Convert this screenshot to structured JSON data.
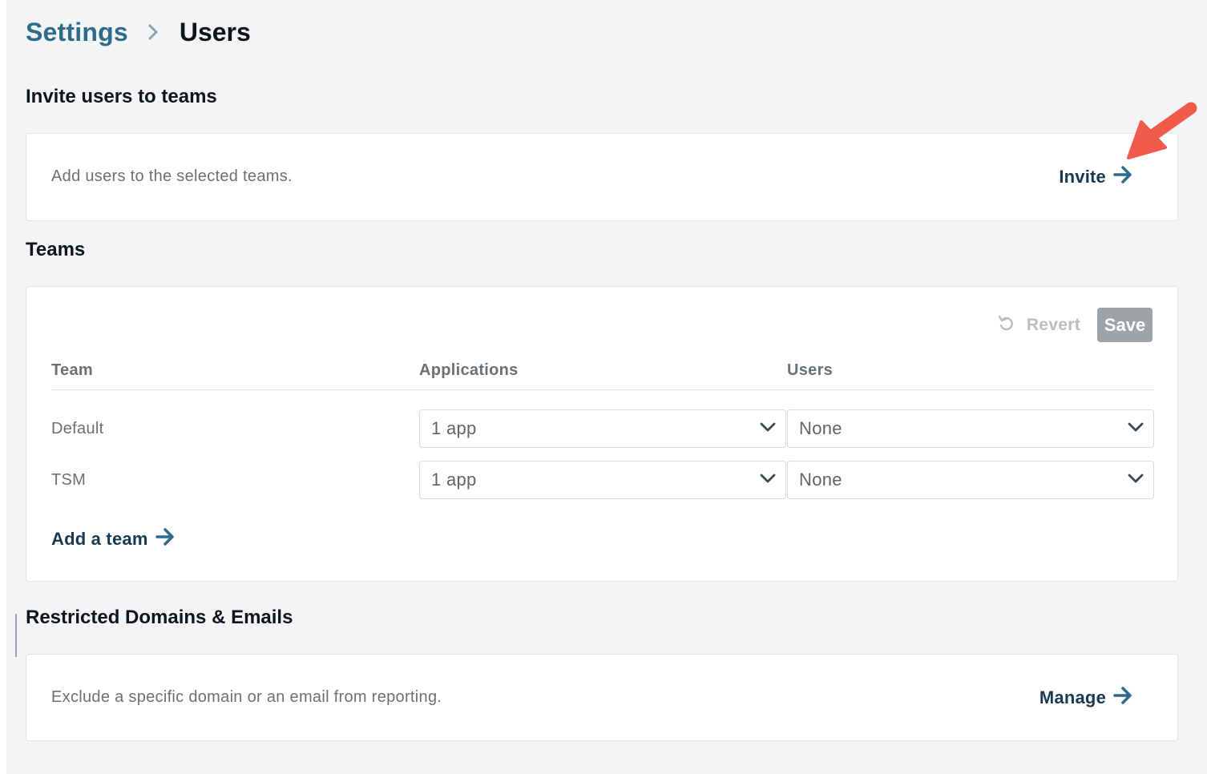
{
  "breadcrumb": {
    "parent": "Settings",
    "current": "Users"
  },
  "invite_section": {
    "title": "Invite users to teams",
    "description": "Add users to the selected teams.",
    "action_label": "Invite"
  },
  "teams_section": {
    "title": "Teams",
    "revert_label": "Revert",
    "save_label": "Save",
    "columns": [
      "Team",
      "Applications",
      "Users"
    ],
    "rows": [
      {
        "team": "Default",
        "applications": "1 app",
        "users": "None"
      },
      {
        "team": "TSM",
        "applications": "1 app",
        "users": "None"
      }
    ],
    "add_team_label": "Add a team"
  },
  "restricted_section": {
    "title": "Restricted Domains & Emails",
    "description": "Exclude a specific domain or an email from reporting.",
    "action_label": "Manage"
  },
  "icons": {
    "breadcrumb_separator": "chevron-right-icon",
    "action_arrow": "arrow-right-icon",
    "revert": "undo-icon",
    "dropdown": "chevron-down-icon",
    "annotation": "annotation-arrow-icon"
  },
  "colors": {
    "page_background": "#f3f4f6",
    "link": "#2e6a8a",
    "action_text": "#173a52",
    "save_button_disabled": "#9ea3a8",
    "annotation_arrow": "#f05a4a"
  }
}
